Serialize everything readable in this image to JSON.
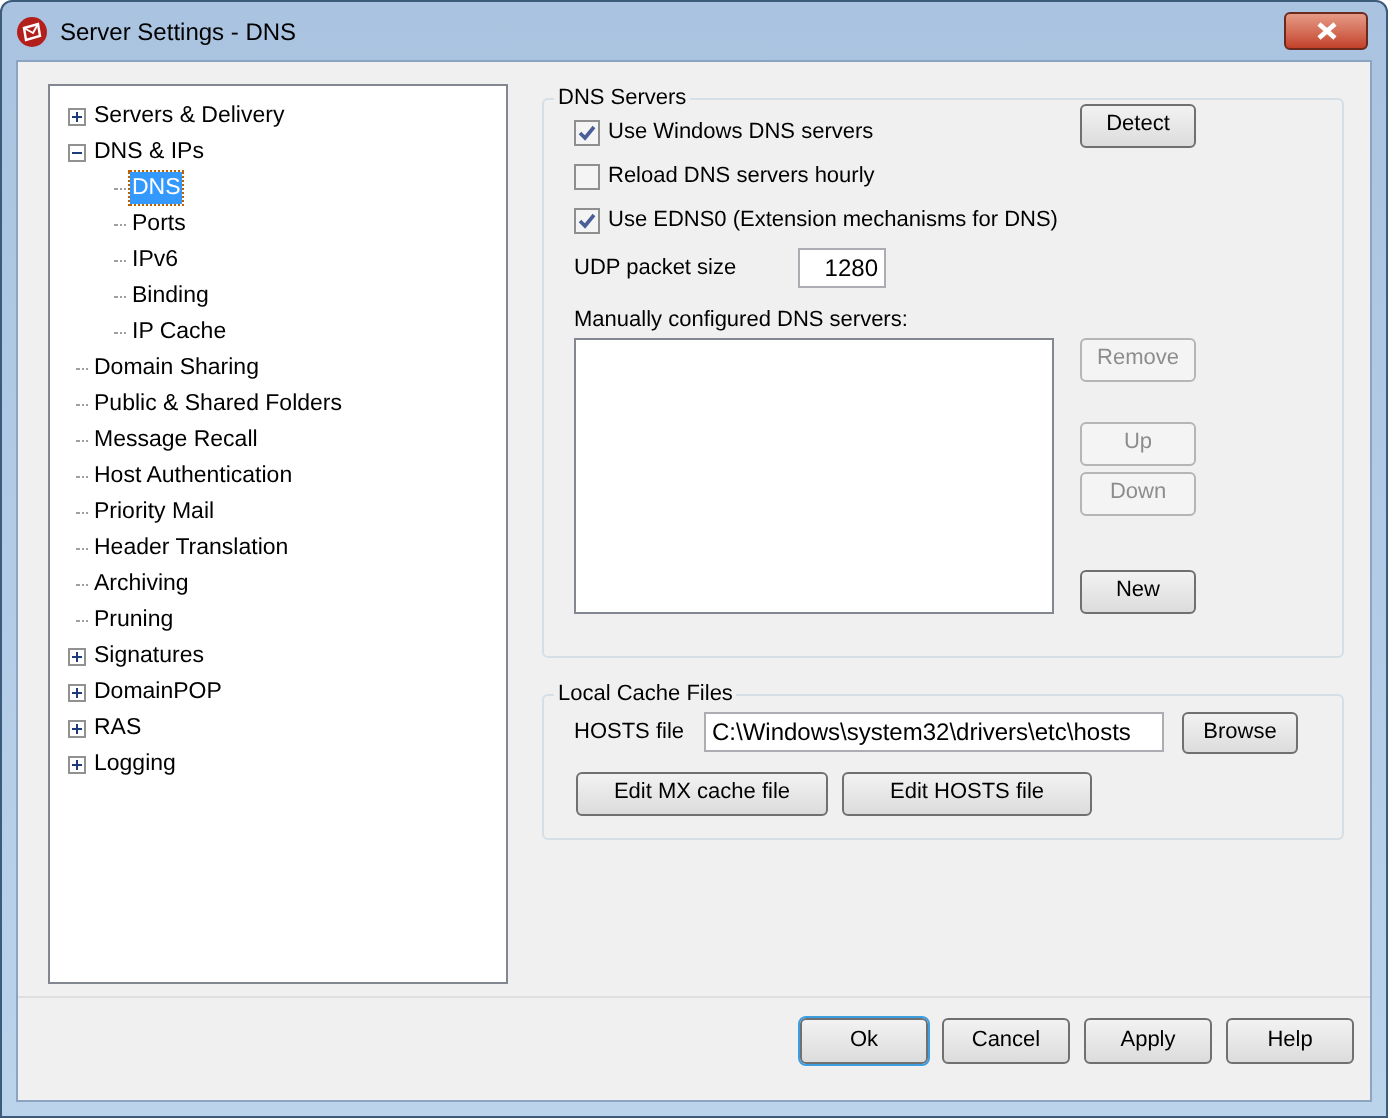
{
  "window": {
    "title": "Server Settings - DNS"
  },
  "tree": [
    {
      "label": "Servers & Delivery",
      "expanded": false,
      "selected": false
    },
    {
      "label": "DNS & IPs",
      "expanded": true,
      "selected": false,
      "children": [
        {
          "label": "DNS",
          "selected": true
        },
        {
          "label": "Ports",
          "selected": false
        },
        {
          "label": "IPv6",
          "selected": false
        },
        {
          "label": "Binding",
          "selected": false
        },
        {
          "label": "IP Cache",
          "selected": false
        }
      ]
    },
    {
      "label": "Domain Sharing",
      "selected": false
    },
    {
      "label": "Public & Shared Folders",
      "selected": false
    },
    {
      "label": "Message Recall",
      "selected": false
    },
    {
      "label": "Host Authentication",
      "selected": false
    },
    {
      "label": "Priority Mail",
      "selected": false
    },
    {
      "label": "Header Translation",
      "selected": false
    },
    {
      "label": "Archiving",
      "selected": false
    },
    {
      "label": "Pruning",
      "selected": false
    },
    {
      "label": "Signatures",
      "expanded": false,
      "selected": false
    },
    {
      "label": "DomainPOP",
      "expanded": false,
      "selected": false
    },
    {
      "label": "RAS",
      "expanded": false,
      "selected": false
    },
    {
      "label": "Logging",
      "expanded": false,
      "selected": false
    }
  ],
  "dns_servers": {
    "title": "DNS Servers",
    "checkboxes": [
      {
        "label": "Use Windows DNS servers",
        "checked": true
      },
      {
        "label": "Reload DNS servers hourly",
        "checked": false
      },
      {
        "label": "Use EDNS0 (Extension mechanisms for DNS)",
        "checked": true
      }
    ],
    "detect_button": {
      "label": "Detect",
      "disabled": false
    },
    "udp_packet_size": {
      "label": "UDP packet size",
      "value": "1280"
    },
    "manual_label": "Manually configured DNS servers:",
    "buttons": [
      {
        "label": "Remove",
        "disabled": true
      },
      {
        "label": "Up",
        "disabled": true
      },
      {
        "label": "Down",
        "disabled": true
      },
      {
        "label": "New",
        "disabled": false
      }
    ]
  },
  "local_cache_files": {
    "title": "Local Cache Files",
    "hosts_file": {
      "label": "HOSTS file",
      "value": "C:\\Windows\\system32\\drivers\\etc\\hosts"
    },
    "browse_button": "Browse",
    "buttons": [
      "Edit MX cache file",
      "Edit HOSTS file"
    ]
  },
  "footer_buttons": [
    {
      "label": "Ok",
      "default": true
    },
    {
      "label": "Cancel",
      "default": false
    },
    {
      "label": "Apply",
      "default": false
    },
    {
      "label": "Help",
      "default": false
    }
  ]
}
